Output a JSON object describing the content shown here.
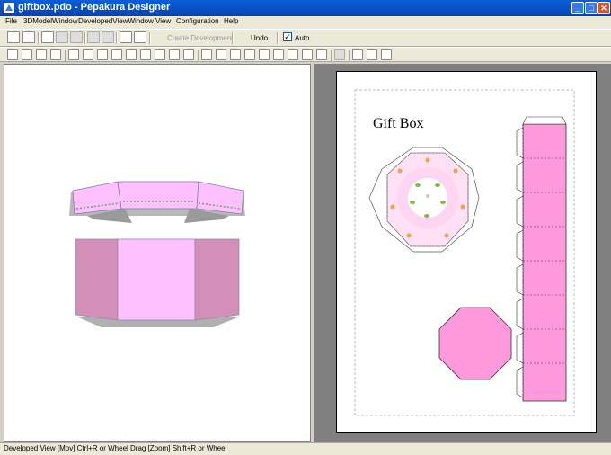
{
  "window": {
    "title": "giftbox.pdo - Pepakura Designer",
    "buttons": [
      "minimize",
      "maximize",
      "close"
    ]
  },
  "menu": [
    "File",
    "3DModelWindow",
    "DevelopedViewWindow",
    "View",
    "Configuration",
    "Help"
  ],
  "toolbar": {
    "create_development_label": "Create Development",
    "undo_label": "Undo",
    "auto_label": "Auto",
    "auto_checked": true
  },
  "paper": {
    "title": "Gift Box"
  },
  "status": {
    "text": "Developed View [Mov] Ctrl+R or Wheel Drag [Zoom] Shift+R or Wheel"
  },
  "colors": {
    "pink_light": "#ffc0ff",
    "pink_mid": "#d48fb8",
    "pink_paper": "#ff99dd",
    "gray_shadow": "#b0b0b0"
  }
}
